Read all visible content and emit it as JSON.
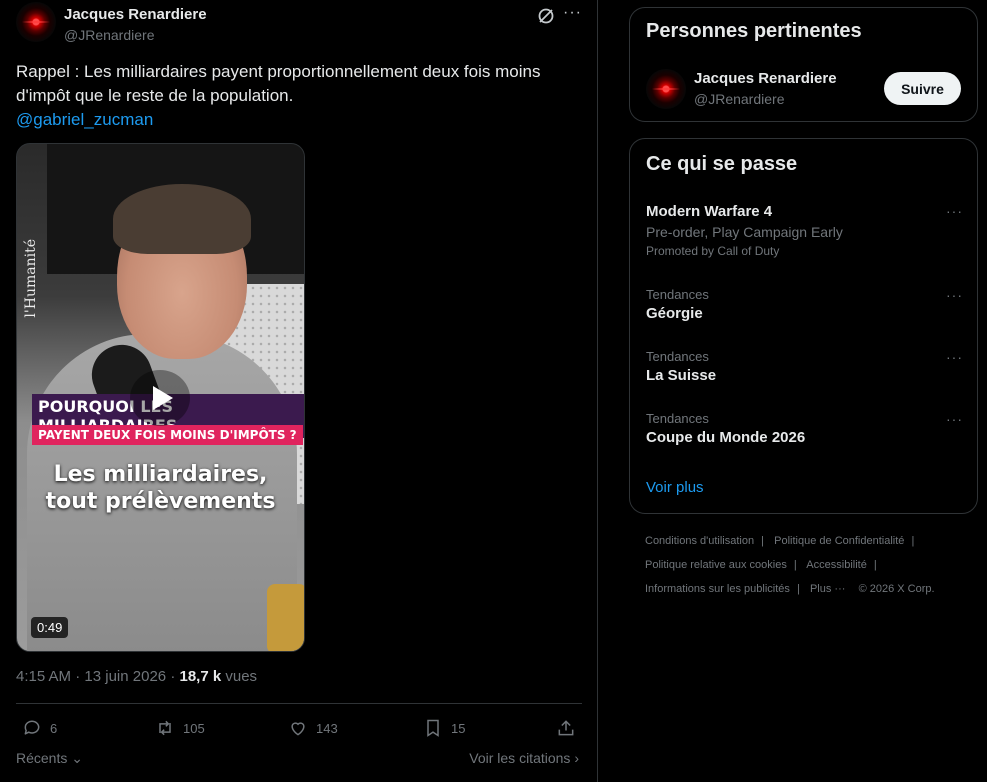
{
  "tweet": {
    "author_name": "Jacques Renardiere",
    "author_handle": "@JRenardiere",
    "text_line1": "Rappel : Les milliardaires payent proportionnellement deux fois moins",
    "text_line2": "d'impôt que le reste de la population.",
    "mention": "@gabriel_zucman",
    "video": {
      "side_text": "l'Humanité",
      "banner1": "POURQUOI LES MILLIARDAIRES",
      "banner2": "PAYENT DEUX FOIS MOINS D'IMPÔTS ?",
      "caption1": "Les milliardaires,",
      "caption2": "tout prélèvements",
      "duration": "0:49"
    },
    "time": "4:15 AM",
    "date": "13 juin 2026",
    "views_count": "18,7 k",
    "views_label": "vues",
    "replies": "6",
    "reposts": "105",
    "likes": "143",
    "bookmarks": "15",
    "sort_label": "Récents",
    "quotes_label": "Voir les citations"
  },
  "relevant": {
    "title": "Personnes pertinentes",
    "name": "Jacques Renardiere",
    "handle": "@JRenardiere",
    "follow_label": "Suivre"
  },
  "trending": {
    "title": "Ce qui se passe",
    "items": [
      {
        "title": "Modern Warfare 4",
        "subtitle": "Pre-order, Play Campaign Early",
        "promoted": "Promoted by Call of Duty"
      },
      {
        "context": "Tendances",
        "title": "Géorgie"
      },
      {
        "context": "Tendances",
        "title": "La Suisse"
      },
      {
        "context": "Tendances",
        "title": "Coupe du Monde 2026"
      }
    ],
    "show_more": "Voir plus"
  },
  "footer": {
    "terms": "Conditions d'utilisation",
    "privacy": "Politique de Confidentialité",
    "cookies": "Politique relative aux cookies",
    "accessibility": "Accessibilité",
    "ads": "Informations sur les publicités",
    "more": "Plus ···",
    "copyright": "© 2026 X Corp."
  },
  "colors": {
    "accent": "#1d9bf0",
    "muted": "#71767b",
    "text": "#e7e9ea",
    "border": "#2f3336"
  }
}
